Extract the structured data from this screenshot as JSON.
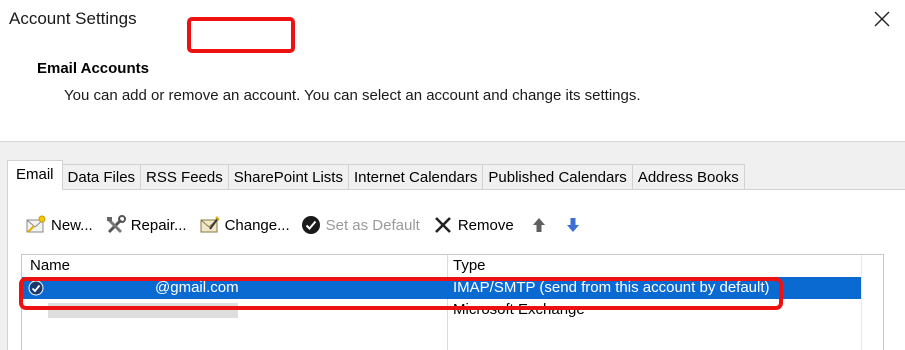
{
  "window": {
    "title": "Account Settings"
  },
  "header": {
    "title": "Email Accounts",
    "description": "You can add or remove an account. You can select an account and change its settings."
  },
  "tabs": [
    {
      "label": "Email",
      "active": true
    },
    {
      "label": "Data Files"
    },
    {
      "label": "RSS Feeds"
    },
    {
      "label": "SharePoint Lists"
    },
    {
      "label": "Internet Calendars"
    },
    {
      "label": "Published Calendars"
    },
    {
      "label": "Address Books"
    }
  ],
  "toolbar": {
    "new_label": "New...",
    "repair_label": "Repair...",
    "change_label": "Change...",
    "set_default_label": "Set as Default",
    "remove_label": "Remove"
  },
  "accounts": {
    "columns": [
      "Name",
      "Type"
    ],
    "rows": [
      {
        "name": "@gmail.com",
        "type": "IMAP/SMTP (send from this account by default)",
        "selected": true,
        "default": true
      },
      {
        "name": "",
        "type": "Microsoft Exchange",
        "selected": false,
        "default": false
      }
    ]
  },
  "colors": {
    "selection": "#0a6ad2",
    "highlight": "#ee1111"
  }
}
